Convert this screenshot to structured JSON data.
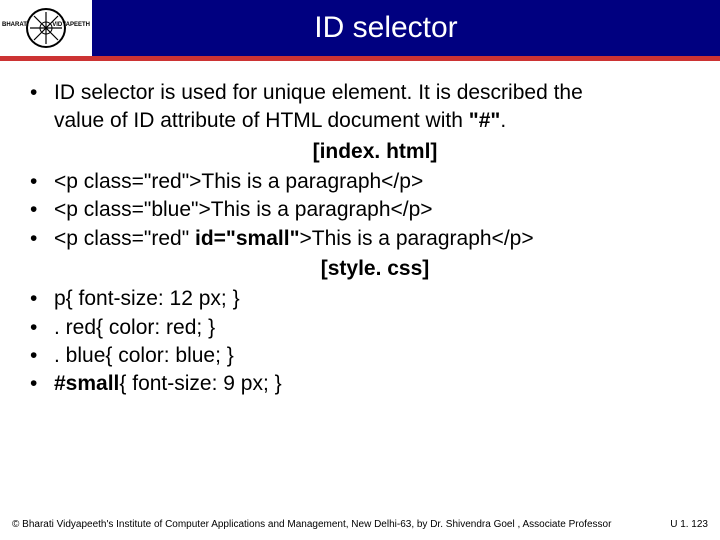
{
  "header": {
    "title": "ID selector",
    "logo_left": "BHARATI",
    "logo_right": "VIDYAPEETH"
  },
  "bullets": {
    "b1a": "ID selector is used for unique element. It is described the",
    "b1b": "value of ID attribute of HTML document with ",
    "b1c": "\"#\"",
    "b1d": ".",
    "file1": "[index. html]",
    "b2": "<p class=\"red\">This is a paragraph</p>",
    "b3": " <p class=\"blue\">This is a paragraph</p>",
    "b4a": "  <p class=\"red\" ",
    "b4b": "id=\"small\"",
    "b4c": ">This is a paragraph</p>",
    "file2": "[style. css]",
    "b5": "p{ font-size: 12 px; }",
    "b6": ". red{ color: red; }",
    "b7": ". blue{ color: blue; }",
    "b8a": "#small",
    "b8b": "{ font-size: 9 px; }"
  },
  "footer": {
    "copy": "© Bharati Vidyapeeth's Institute of Computer Applications and Management, New Delhi-63, by Dr. Shivendra Goel , Associate Professor",
    "page": "U 1.  123"
  }
}
